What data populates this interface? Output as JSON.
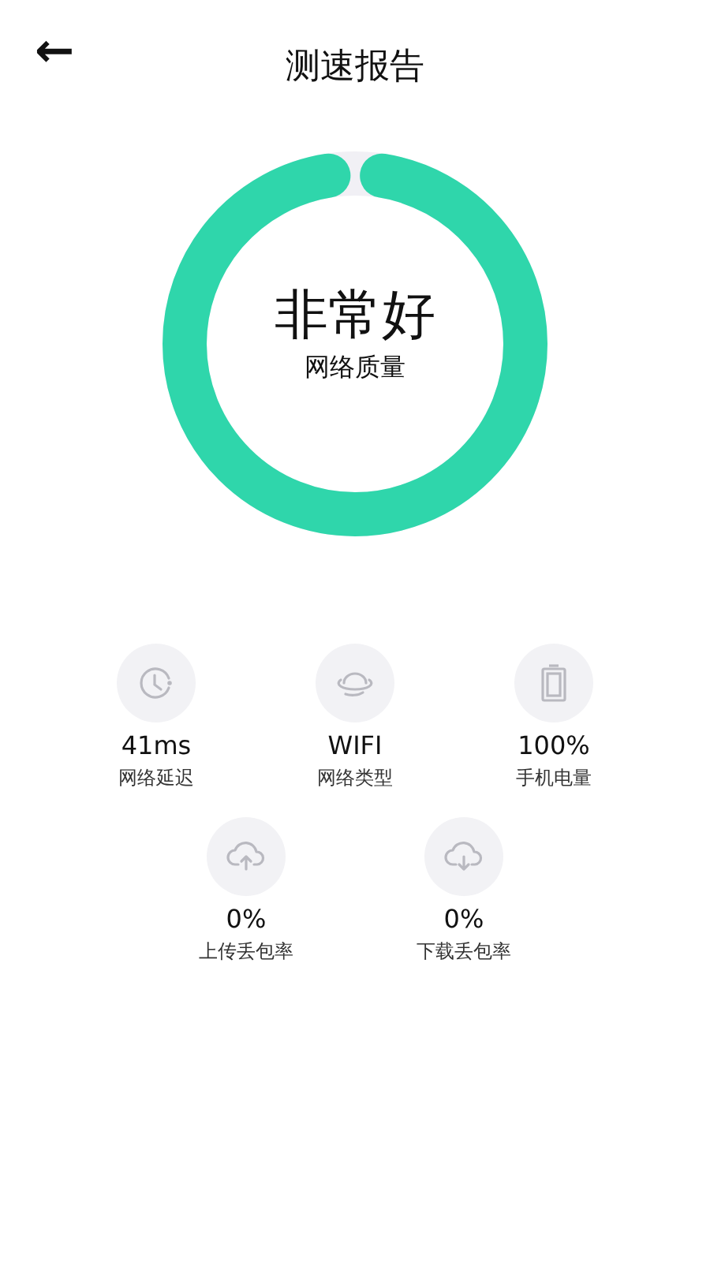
{
  "header": {
    "back_icon": "←",
    "title": "测速报告"
  },
  "gauge": {
    "level": 0.97,
    "rating": "非常好",
    "label": "网络质量"
  },
  "stats_row_1": [
    {
      "kind": "clock",
      "value": "41ms",
      "label": "网络延迟"
    },
    {
      "kind": "planet",
      "value": "WIFI",
      "label": "网络类型"
    },
    {
      "kind": "battery",
      "value": "100%",
      "label": "手机电量"
    }
  ],
  "stats_row_2": [
    {
      "kind": "upload",
      "value": "0%",
      "label": "上传丢包率"
    },
    {
      "kind": "download",
      "value": "0%",
      "label": "下载丢包率"
    }
  ]
}
